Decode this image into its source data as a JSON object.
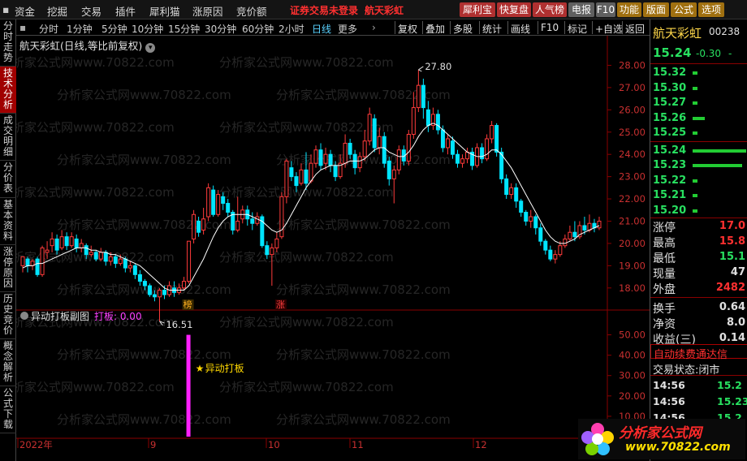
{
  "menu": {
    "items": [
      "资金",
      "挖掘",
      "交易",
      "插件",
      "犀利猫",
      "涨原因",
      "竞价额"
    ],
    "alert": "证券交易未登录",
    "stock_name": "航天彩虹"
  },
  "toolbar": {
    "buttons": [
      {
        "label": "犀利宝",
        "color": "#b03030"
      },
      {
        "label": "快复盘",
        "color": "#b03030"
      },
      {
        "label": "人气榜",
        "color": "#b03030"
      },
      {
        "label": "电报",
        "color": "#606060"
      },
      {
        "label": "F10",
        "color": "#606060"
      },
      {
        "label": "功能",
        "color": "#a07010"
      },
      {
        "label": "版面",
        "color": "#a07010"
      },
      {
        "label": "公式",
        "color": "#a07010"
      },
      {
        "label": "选项",
        "color": "#a07010"
      }
    ]
  },
  "left_tabs": [
    "分时走势",
    "技术分析",
    "成交明细",
    "分价表",
    "基本资料",
    "涨停原因",
    "历史竞价",
    "概念解析",
    "公式下载"
  ],
  "left_tabs_active": 1,
  "periods": [
    "分时",
    "1分钟",
    "5分钟",
    "10分钟",
    "15分钟",
    "30分钟",
    "60分钟",
    "2小时",
    "日线",
    "更多"
  ],
  "period_selected": 8,
  "tools": [
    "复权",
    "叠加",
    "多股",
    "统计",
    "画线",
    "F10",
    "标记",
    "+自选",
    "返回"
  ],
  "chart": {
    "title": "航天彩虹(日线,等比前复权)",
    "title_icon": "circle-arrow-icon",
    "y_ticks": [
      "28.00",
      "27.00",
      "26.00",
      "25.00",
      "24.00",
      "23.00",
      "22.00",
      "21.00",
      "20.00",
      "19.00",
      "18.00"
    ],
    "high_label": "27.80",
    "low_label": "16.51",
    "marker_bang": "榜",
    "marker_zhang": "涨",
    "watermark": "分析家公式网www.70822.com",
    "indicator_title": "异动打板副图",
    "indicator_value_label": "打板: 0.00",
    "indicator_ticks": [
      "50.00",
      "40.00",
      "30.00",
      "20.00",
      "10.00"
    ],
    "signal_label": "异动打板",
    "x_labels": [
      "2022年",
      "9",
      "10",
      "11",
      "12"
    ],
    "up_color": "#ff3b3b",
    "down_color": "#00e5ff",
    "ma_color": "#ffffff"
  },
  "chart_data": {
    "type": "candlestick",
    "title": "航天彩虹(日线,等比前复权)",
    "ylim": [
      17.3,
      28.6
    ],
    "candles": [
      [
        19.0,
        19.4,
        18.7,
        19.1
      ],
      [
        19.3,
        19.0,
        18.7,
        19.4
      ],
      [
        19.0,
        19.2,
        18.8,
        19.3
      ],
      [
        19.3,
        18.6,
        18.5,
        19.4
      ],
      [
        18.6,
        19.8,
        18.5,
        19.9
      ],
      [
        19.6,
        19.7,
        19.3,
        20.1
      ],
      [
        19.9,
        20.2,
        19.6,
        20.5
      ],
      [
        20.2,
        19.7,
        19.5,
        20.4
      ],
      [
        19.8,
        20.3,
        19.7,
        20.6
      ],
      [
        20.3,
        19.9,
        19.7,
        20.5
      ],
      [
        19.9,
        20.3,
        19.8,
        20.5
      ],
      [
        20.2,
        19.8,
        19.6,
        20.4
      ],
      [
        19.8,
        20.0,
        19.6,
        20.2
      ],
      [
        19.9,
        19.5,
        19.3,
        20.0
      ],
      [
        19.5,
        19.6,
        19.4,
        19.9
      ],
      [
        19.6,
        19.3,
        19.2,
        19.7
      ],
      [
        19.3,
        19.6,
        19.2,
        19.8
      ],
      [
        19.6,
        19.2,
        19.0,
        19.7
      ],
      [
        19.2,
        19.4,
        19.0,
        19.6
      ],
      [
        19.4,
        19.1,
        18.9,
        19.5
      ],
      [
        19.1,
        19.3,
        19.0,
        19.5
      ],
      [
        19.3,
        18.9,
        18.7,
        19.4
      ],
      [
        18.9,
        19.0,
        18.7,
        19.2
      ],
      [
        19.0,
        18.6,
        18.4,
        19.1
      ],
      [
        18.6,
        18.3,
        18.1,
        18.8
      ],
      [
        18.3,
        18.1,
        17.9,
        18.4
      ],
      [
        18.1,
        17.7,
        17.6,
        18.2
      ],
      [
        17.7,
        17.6,
        17.4,
        17.9
      ],
      [
        17.6,
        17.9,
        16.5,
        18.0
      ],
      [
        17.9,
        17.7,
        17.5,
        18.1
      ],
      [
        17.7,
        18.1,
        17.6,
        18.3
      ],
      [
        18.0,
        17.8,
        17.6,
        18.3
      ],
      [
        17.8,
        18.0,
        17.7,
        18.2
      ],
      [
        18.0,
        18.3,
        17.9,
        18.5
      ],
      [
        18.3,
        20.1,
        18.2,
        20.1
      ],
      [
        20.2,
        21.3,
        20.0,
        21.5
      ],
      [
        21.0,
        20.5,
        20.3,
        21.2
      ],
      [
        20.6,
        21.1,
        20.4,
        21.6
      ],
      [
        21.2,
        22.5,
        21.0,
        22.7
      ],
      [
        22.4,
        21.3,
        21.2,
        22.6
      ],
      [
        21.3,
        22.2,
        21.2,
        22.4
      ],
      [
        22.1,
        21.8,
        21.5,
        22.3
      ],
      [
        21.8,
        21.4,
        21.2,
        22.0
      ],
      [
        21.4,
        20.6,
        20.4,
        21.5
      ],
      [
        20.6,
        21.0,
        20.5,
        22.1
      ],
      [
        21.1,
        21.5,
        20.9,
        21.7
      ],
      [
        21.5,
        21.1,
        20.8,
        21.7
      ],
      [
        21.1,
        20.9,
        20.6,
        21.4
      ],
      [
        20.9,
        21.2,
        20.8,
        21.4
      ],
      [
        21.2,
        19.9,
        19.8,
        21.3
      ],
      [
        19.9,
        19.5,
        19.3,
        20.1
      ],
      [
        19.5,
        19.8,
        18.1,
        20.0
      ],
      [
        19.8,
        20.2,
        19.6,
        20.5
      ],
      [
        20.3,
        22.1,
        20.2,
        22.3
      ],
      [
        22.1,
        23.7,
        21.8,
        23.8
      ],
      [
        23.4,
        23.0,
        22.8,
        23.7
      ],
      [
        23.0,
        22.6,
        22.3,
        23.2
      ],
      [
        22.7,
        23.3,
        22.6,
        23.6
      ],
      [
        23.3,
        22.7,
        22.4,
        24.1
      ],
      [
        22.8,
        23.6,
        22.7,
        24.0
      ],
      [
        23.6,
        24.2,
        23.4,
        24.4
      ],
      [
        24.2,
        23.5,
        23.3,
        24.5
      ],
      [
        23.6,
        24.0,
        23.3,
        24.3
      ],
      [
        24.0,
        23.5,
        23.2,
        24.2
      ],
      [
        23.5,
        23.0,
        22.8,
        23.7
      ],
      [
        23.0,
        23.6,
        22.9,
        24.0
      ],
      [
        23.6,
        24.5,
        23.4,
        24.9
      ],
      [
        24.5,
        24.0,
        23.8,
        24.7
      ],
      [
        24.0,
        23.4,
        23.1,
        24.2
      ],
      [
        23.4,
        23.9,
        23.2,
        24.1
      ],
      [
        23.9,
        24.6,
        23.7,
        25.1
      ],
      [
        24.6,
        25.8,
        24.4,
        26.1
      ],
      [
        25.6,
        24.3,
        24.1,
        25.8
      ],
      [
        24.3,
        24.8,
        24.0,
        25.2
      ],
      [
        24.8,
        23.6,
        23.4,
        25.0
      ],
      [
        23.7,
        22.9,
        22.6,
        23.9
      ],
      [
        22.9,
        23.3,
        21.8,
        23.5
      ],
      [
        23.3,
        24.2,
        23.1,
        24.4
      ],
      [
        24.2,
        23.7,
        23.5,
        24.4
      ],
      [
        23.7,
        24.9,
        23.5,
        25.1
      ],
      [
        24.9,
        26.1,
        24.7,
        26.8
      ],
      [
        26.1,
        27.1,
        25.9,
        27.8
      ],
      [
        27.1,
        26.1,
        25.6,
        27.4
      ],
      [
        26.0,
        25.3,
        25.0,
        26.4
      ],
      [
        25.3,
        25.8,
        25.1,
        26.1
      ],
      [
        25.8,
        25.1,
        24.9,
        26.0
      ],
      [
        25.1,
        24.3,
        24.1,
        25.3
      ],
      [
        24.3,
        24.7,
        24.0,
        24.9
      ],
      [
        24.6,
        24.0,
        23.8,
        24.8
      ],
      [
        24.0,
        23.6,
        23.4,
        24.2
      ],
      [
        23.6,
        23.8,
        23.4,
        24.0
      ],
      [
        23.8,
        24.1,
        23.6,
        24.3
      ],
      [
        24.1,
        23.5,
        23.3,
        24.3
      ],
      [
        23.5,
        24.3,
        23.4,
        24.5
      ],
      [
        24.3,
        23.8,
        23.6,
        24.5
      ],
      [
        23.8,
        24.7,
        23.7,
        24.9
      ],
      [
        24.7,
        25.3,
        24.5,
        25.5
      ],
      [
        25.3,
        24.1,
        23.9,
        25.4
      ],
      [
        24.1,
        22.9,
        22.7,
        24.3
      ],
      [
        22.9,
        22.2,
        22.0,
        23.1
      ],
      [
        22.2,
        22.5,
        22.0,
        22.7
      ],
      [
        22.5,
        21.9,
        21.6,
        22.7
      ],
      [
        21.9,
        21.4,
        21.2,
        22.0
      ],
      [
        21.4,
        21.0,
        20.8,
        21.5
      ],
      [
        21.0,
        21.2,
        20.7,
        21.5
      ],
      [
        21.2,
        20.7,
        20.4,
        21.3
      ],
      [
        20.7,
        20.1,
        19.9,
        20.9
      ],
      [
        20.1,
        19.7,
        19.5,
        20.2
      ],
      [
        19.7,
        19.3,
        19.2,
        19.9
      ],
      [
        19.3,
        19.5,
        19.1,
        19.7
      ],
      [
        19.5,
        19.9,
        19.4,
        20.1
      ],
      [
        19.9,
        20.2,
        19.8,
        20.4
      ],
      [
        20.2,
        20.5,
        20.1,
        20.8
      ],
      [
        20.5,
        20.3,
        20.1,
        21.0
      ],
      [
        20.3,
        20.8,
        20.2,
        21.0
      ],
      [
        20.8,
        20.6,
        20.4,
        21.2
      ],
      [
        20.6,
        20.9,
        20.5,
        21.3
      ],
      [
        20.9,
        20.7,
        20.5,
        21.1
      ],
      [
        20.7,
        21.0,
        20.6,
        21.2
      ]
    ],
    "ma": [
      18.9,
      19.0,
      19.0,
      19.1,
      19.1,
      19.2,
      19.3,
      19.4,
      19.5,
      19.6,
      19.7,
      19.8,
      19.8,
      19.8,
      19.7,
      19.7,
      19.6,
      19.6,
      19.5,
      19.5,
      19.4,
      19.3,
      19.2,
      19.1,
      19.0,
      18.8,
      18.6,
      18.4,
      18.2,
      18.0,
      17.9,
      17.9,
      17.9,
      17.9,
      18.1,
      18.5,
      18.9,
      19.3,
      19.8,
      20.3,
      20.7,
      21.0,
      21.2,
      21.3,
      21.3,
      21.3,
      21.3,
      21.2,
      21.1,
      21.0,
      20.8,
      20.6,
      20.5,
      20.6,
      20.9,
      21.3,
      21.7,
      22.1,
      22.5,
      22.8,
      23.1,
      23.3,
      23.4,
      23.5,
      23.5,
      23.5,
      23.6,
      23.7,
      23.7,
      23.7,
      23.8,
      24.0,
      24.2,
      24.3,
      24.3,
      24.1,
      24.0,
      23.9,
      23.9,
      24.1,
      24.4,
      24.8,
      25.1,
      25.3,
      25.4,
      25.3,
      25.1,
      24.9,
      24.7,
      24.5,
      24.3,
      24.1,
      24.0,
      23.9,
      23.9,
      24.0,
      24.2,
      24.2,
      24.0,
      23.7,
      23.4,
      23.0,
      22.6,
      22.2,
      21.8,
      21.4,
      21.0,
      20.6,
      20.3,
      20.1,
      20.0,
      20.0,
      20.1,
      20.2,
      20.4,
      20.5,
      20.6,
      20.7,
      20.8
    ],
    "high": 27.8,
    "low": 16.51,
    "indicator": {
      "name": "异动打板",
      "value": 0.0,
      "ylim": [
        0,
        55
      ],
      "signal_index": 34,
      "signal_value": 50
    }
  },
  "quote": {
    "name": "航天彩虹",
    "code": "00238",
    "price": "15.24",
    "change": "-0.30",
    "pct": "-",
    "order_book": [
      {
        "price": "15.32",
        "bar": 10
      },
      {
        "price": "15.30",
        "bar": 10
      },
      {
        "price": "15.27",
        "bar": 10
      },
      {
        "price": "15.26",
        "bar": 28
      },
      {
        "price": "15.25",
        "bar": 10
      },
      {
        "price": "15.24",
        "bar": 120
      },
      {
        "price": "15.23",
        "bar": 110
      },
      {
        "price": "15.22",
        "bar": 10
      },
      {
        "price": "15.21",
        "bar": 10
      },
      {
        "price": "15.20",
        "bar": 10
      }
    ],
    "stats": [
      {
        "label": "涨停",
        "value": "17.0",
        "color": "#ff3030"
      },
      {
        "label": "最高",
        "value": "15.8",
        "color": "#ff3030"
      },
      {
        "label": "最低",
        "value": "15.1",
        "color": "#28e060"
      },
      {
        "label": "现量",
        "value": "47",
        "color": "#e0e0e0"
      },
      {
        "label": "外盘",
        "value": "2482",
        "color": "#ff3030"
      },
      {
        "label": "换手",
        "value": "0.64",
        "color": "#e0e0e0"
      },
      {
        "label": "净资",
        "value": "8.0",
        "color": "#e0e0e0"
      },
      {
        "label": "收益(三)",
        "value": "0.14",
        "color": "#e0e0e0"
      }
    ],
    "ad_text": "自动续费通达信",
    "trade_status": "交易状态:闭市",
    "ticks": [
      {
        "time": "14:56",
        "price": "15.2"
      },
      {
        "time": "14:56",
        "price": "15.23"
      },
      {
        "time": "14:56",
        "price": "15.2"
      }
    ],
    "logo_text": "分析家公式网",
    "logo_url": "www.70822.com"
  }
}
